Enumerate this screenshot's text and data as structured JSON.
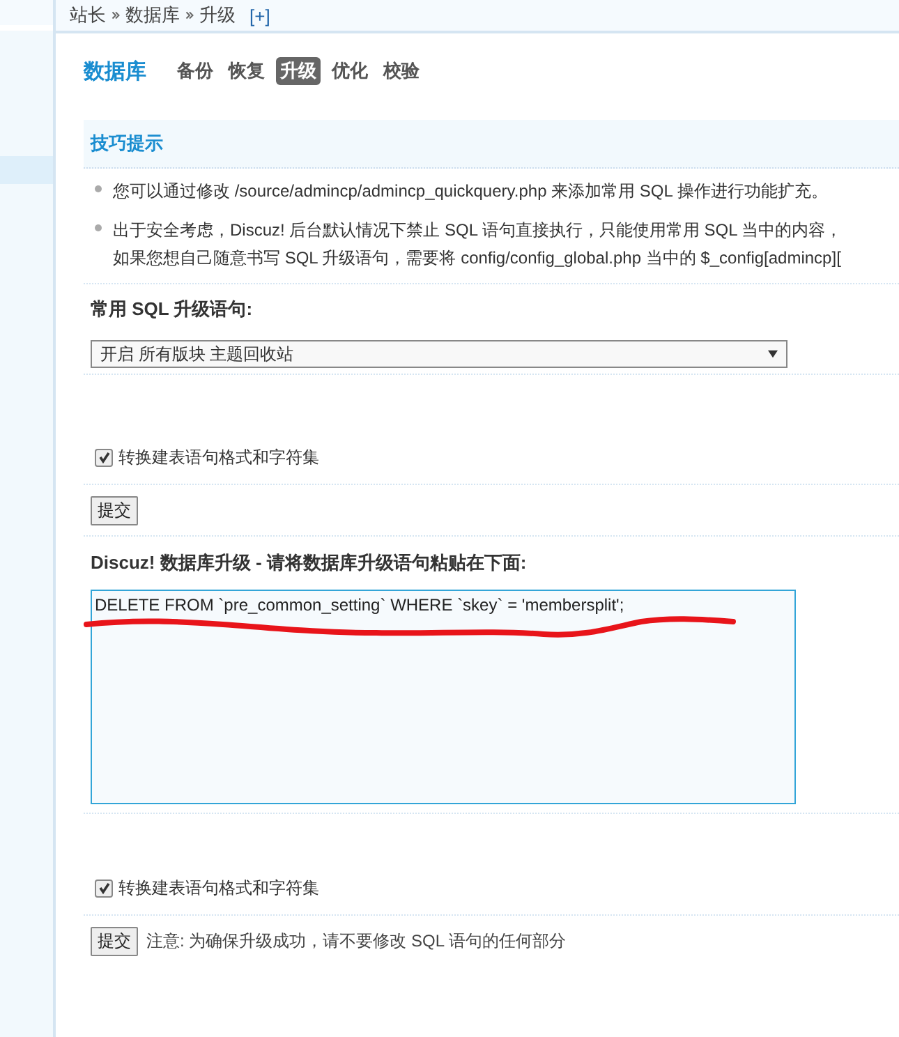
{
  "breadcrumb": {
    "items": [
      "站长",
      "数据库",
      "升级"
    ],
    "add": "[+]"
  },
  "nav": {
    "title": "数据库",
    "tabs": [
      {
        "label": "备份",
        "selected": false
      },
      {
        "label": "恢复",
        "selected": false
      },
      {
        "label": "升级",
        "selected": true
      },
      {
        "label": "优化",
        "selected": false
      },
      {
        "label": "校验",
        "selected": false
      }
    ]
  },
  "tips": {
    "title": "技巧提示",
    "items": [
      {
        "lines": [
          "您可以通过修改 /source/admincp/admincp_quickquery.php 来添加常用 SQL 操作进行功能扩充。"
        ]
      },
      {
        "lines": [
          "出于安全考虑，Discuz! 后台默认情况下禁止 SQL 语句直接执行，只能使用常用 SQL 当中的内容，",
          "如果您想自己随意书写 SQL 升级语句，需要将 config/config_global.php 当中的 $_config[admincp]["
        ]
      }
    ]
  },
  "quick": {
    "label": "常用 SQL 升级语句:",
    "select": "开启 所有版块 主题回收站",
    "checkbox": {
      "label": "转换建表语句格式和字符集",
      "checked": true
    },
    "button": "提交"
  },
  "upgrade": {
    "label": "Discuz! 数据库升级 - 请将数据库升级语句粘贴在下面:",
    "value": "DELETE FROM `pre_common_setting` WHERE `skey` = 'membersplit';",
    "annotation": {
      "kind": "underline"
    },
    "checkbox": {
      "label": "转换建表语句格式和字符集",
      "checked": true
    },
    "button": "提交",
    "note": "注意: 为确保升级成功，请不要修改 SQL 语句的任何部分"
  }
}
